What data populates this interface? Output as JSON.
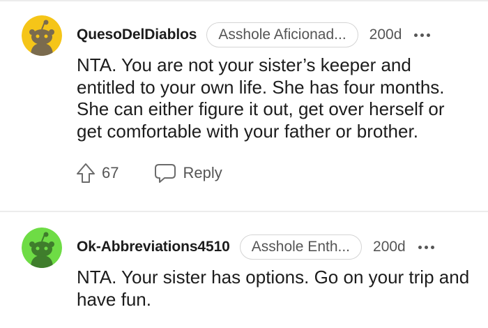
{
  "comments": [
    {
      "username": "QuesoDelDiablos",
      "flair": "Asshole Aficionad...",
      "age": "200d",
      "text": "NTA. You are not your sister’s keeper and entitled to your own life. She has four months. She can either figure it out, get over herself or get comfortable with your father or brother.",
      "upvotes": "67",
      "reply_label": "Reply",
      "avatar_color": "#f5c518",
      "avatar_icon": "snoo-avatar-icon"
    },
    {
      "username": "Ok-Abbreviations4510",
      "flair": "Asshole Enth...",
      "age": "200d",
      "text": "NTA. Your sister has options. Go on your trip and have fun.",
      "avatar_color": "#6edc45",
      "avatar_icon": "snoo-avatar-icon"
    }
  ],
  "colors": {
    "text": "#1c1c1c",
    "meta": "#555555",
    "divider": "#ececec"
  }
}
